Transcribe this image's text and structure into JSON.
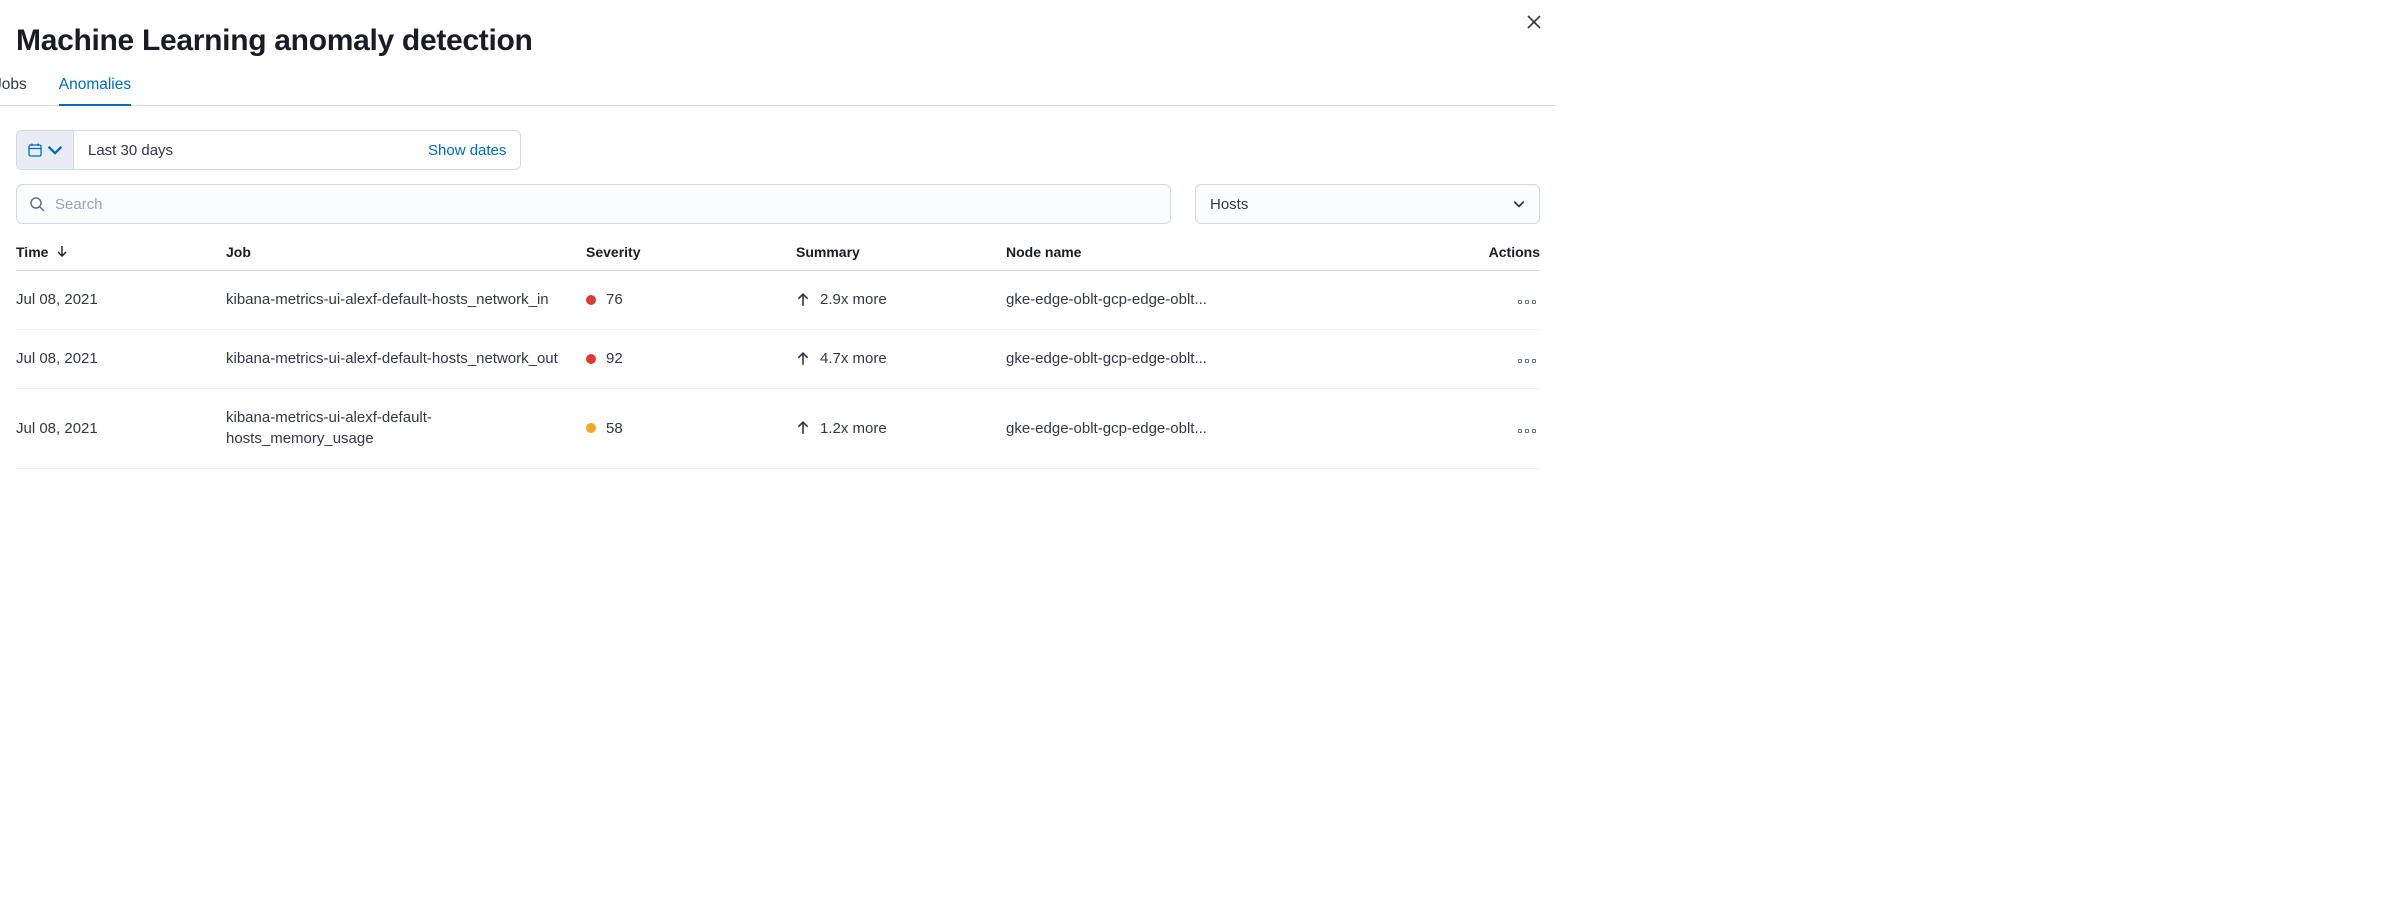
{
  "header": {
    "title": "Machine Learning anomaly detection"
  },
  "tabs": [
    {
      "label": "Jobs",
      "active": false
    },
    {
      "label": "Anomalies",
      "active": true
    }
  ],
  "date_picker": {
    "range_label": "Last 30 days",
    "show_dates_label": "Show dates"
  },
  "search": {
    "placeholder": "Search",
    "value": ""
  },
  "filter_select": {
    "selected": "Hosts"
  },
  "table": {
    "columns": {
      "time": "Time",
      "job": "Job",
      "severity": "Severity",
      "summary": "Summary",
      "node_name": "Node name",
      "actions": "Actions"
    },
    "sort": {
      "column": "time",
      "direction": "desc"
    },
    "rows": [
      {
        "time": "Jul 08, 2021",
        "job": "kibana-metrics-ui-alexf-default-hosts_network_in",
        "severity": {
          "value": "76",
          "color": "red"
        },
        "summary": {
          "direction": "up",
          "text": "2.9x more"
        },
        "node_name": "gke-edge-oblt-gcp-edge-oblt..."
      },
      {
        "time": "Jul 08, 2021",
        "job": "kibana-metrics-ui-alexf-default-hosts_network_out",
        "severity": {
          "value": "92",
          "color": "red"
        },
        "summary": {
          "direction": "up",
          "text": "4.7x more"
        },
        "node_name": "gke-edge-oblt-gcp-edge-oblt..."
      },
      {
        "time": "Jul 08, 2021",
        "job": "kibana-metrics-ui-alexf-default-hosts_memory_usage",
        "severity": {
          "value": "58",
          "color": "orange"
        },
        "summary": {
          "direction": "up",
          "text": "1.2x more"
        },
        "node_name": "gke-edge-oblt-gcp-edge-oblt..."
      }
    ]
  }
}
